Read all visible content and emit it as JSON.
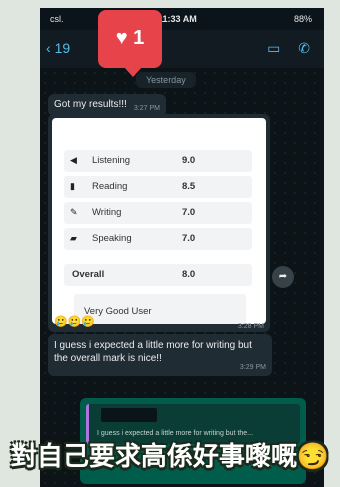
{
  "status": {
    "carrier": "csl.",
    "time": "11:33 AM",
    "battery": "88%"
  },
  "header": {
    "back_label": "19"
  },
  "notification": {
    "count": "1"
  },
  "chat": {
    "date_label": "Yesterday",
    "msg1": {
      "text": "Got my results!!!",
      "time": "3:27 PM"
    },
    "scores": [
      {
        "icon": "megaphone-icon",
        "label": "Listening",
        "score": "9.0"
      },
      {
        "icon": "book-icon",
        "label": "Reading",
        "score": "8.5"
      },
      {
        "icon": "pen-icon",
        "label": "Writing",
        "score": "7.0"
      },
      {
        "icon": "speech-icon",
        "label": "Speaking",
        "score": "7.0"
      }
    ],
    "overall": {
      "label": "Overall",
      "score": "8.0"
    },
    "band": "Very Good User",
    "img_emojis": "🥲🥲🥲",
    "img_time": "3:28 PM",
    "msg3": {
      "text": "I guess i expected a little more for writing but the overall mark is nice!!",
      "time": "3:29 PM"
    },
    "reply_quote": "I guess i expected a little more for writing but the..."
  },
  "caption": "對自己要求高係好事嚟嘅😏"
}
